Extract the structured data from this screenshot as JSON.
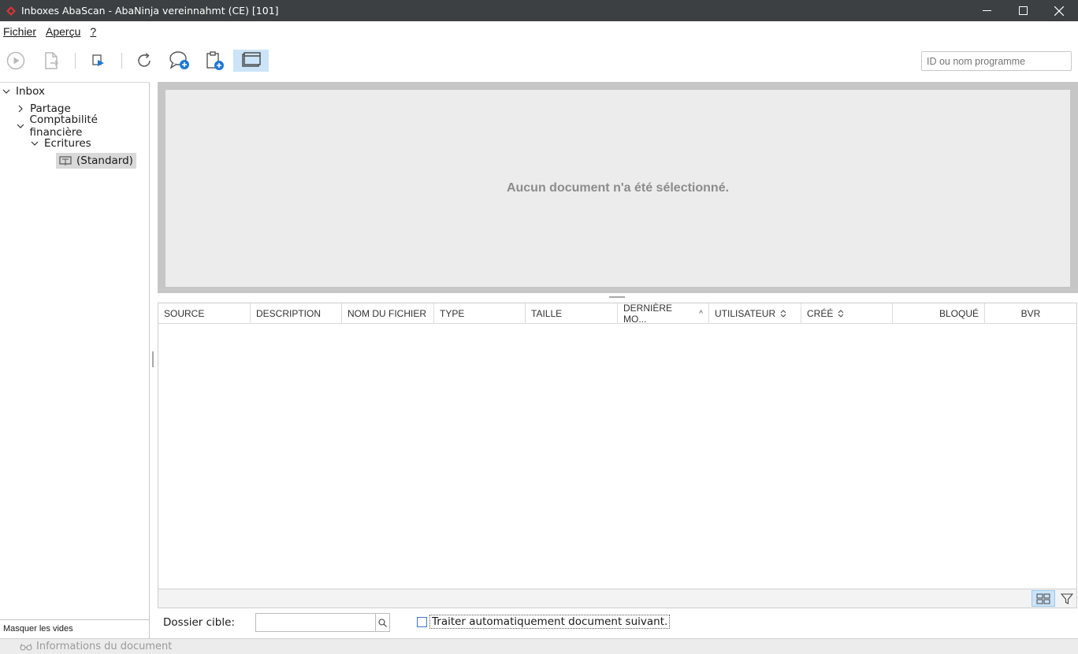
{
  "window": {
    "title": "Inboxes AbaScan - AbaNinja vereinnahmt (CE) [101]"
  },
  "menu": {
    "items": [
      "Fichier",
      "Aperçu",
      "?"
    ]
  },
  "toolbar": {
    "search_placeholder": "ID ou nom programme",
    "buttons": [
      "play-icon",
      "export-document-icon",
      "send-icon",
      "refresh-icon",
      "add-comment-icon",
      "add-clipboard-icon",
      "window-view-icon"
    ]
  },
  "tree": {
    "items": [
      {
        "label": "Inbox",
        "expanded": true
      },
      {
        "label": "Partage",
        "expanded": false
      },
      {
        "label": "Comptabilité financière",
        "expanded": true
      },
      {
        "label": "Ecritures",
        "expanded": true
      },
      {
        "label": "(Standard)",
        "selected": true
      }
    ],
    "footer": "Masquer les vides"
  },
  "preview": {
    "message": "Aucun document n'a été sélectionné."
  },
  "table": {
    "columns": [
      "SOURCE",
      "DESCRIPTION",
      "NOM DU FICHIER",
      "TYPE",
      "TAILLE",
      "DERNIÈRE MO...",
      "UTILISATEUR",
      "CRÉÉ",
      "BLOQUÉ",
      "BVR"
    ],
    "rows": []
  },
  "bottom": {
    "target_label": "Dossier cible:",
    "target_value": "",
    "auto_label": "Traiter automatiquement document suivant.",
    "auto_checked": false
  },
  "status": {
    "doc_info": "Informations du document"
  },
  "colors": {
    "titlebar": "#3c4043",
    "accent": "#1e78d7",
    "active_button": "#cce4f7"
  }
}
